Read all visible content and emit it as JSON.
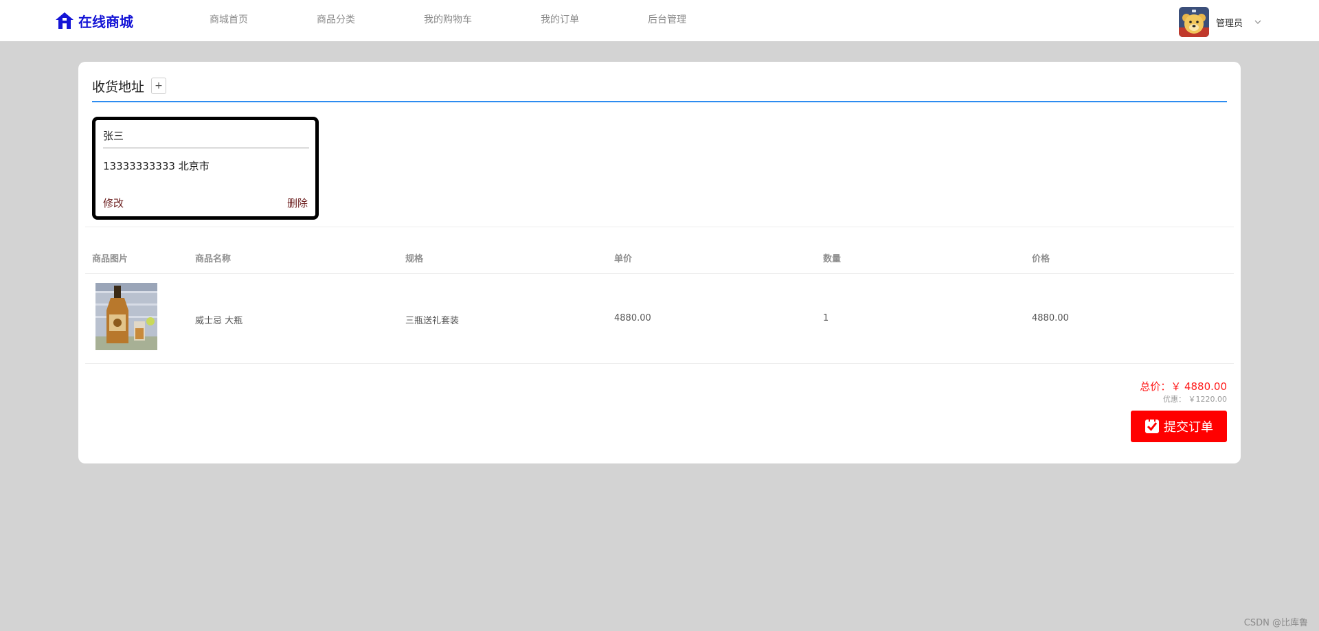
{
  "brand": {
    "title": "在线商城",
    "icon": "home-icon",
    "color": "#1515d6"
  },
  "nav": [
    {
      "label": "商城首页"
    },
    {
      "label": "商品分类"
    },
    {
      "label": "我的购物车"
    },
    {
      "label": "我的订单"
    },
    {
      "label": "后台管理"
    }
  ],
  "user": {
    "name": "管理员",
    "avatar": "bear-avatar"
  },
  "address_section": {
    "title": "收货地址",
    "add_label": "+"
  },
  "address": {
    "name": "张三",
    "detail": "13333333333 北京市",
    "edit_label": "修改",
    "delete_label": "删除"
  },
  "table": {
    "headers": [
      "商品图片",
      "商品名称",
      "规格",
      "单价",
      "数量",
      "价格"
    ],
    "rows": [
      {
        "name": "威士忌 大瓶",
        "spec": "三瓶送礼套装",
        "unit_price": "4880.00",
        "qty": "1",
        "price": "4880.00"
      }
    ]
  },
  "summary": {
    "total": "总价：￥ 4880.00",
    "discount": "优惠： ￥1220.00",
    "submit_label": "提交订单"
  },
  "colors": {
    "accent": "#2d8cf0",
    "submit": "#ff0000",
    "total": "#ff1a1a"
  },
  "watermark": "CSDN @比库鲁"
}
